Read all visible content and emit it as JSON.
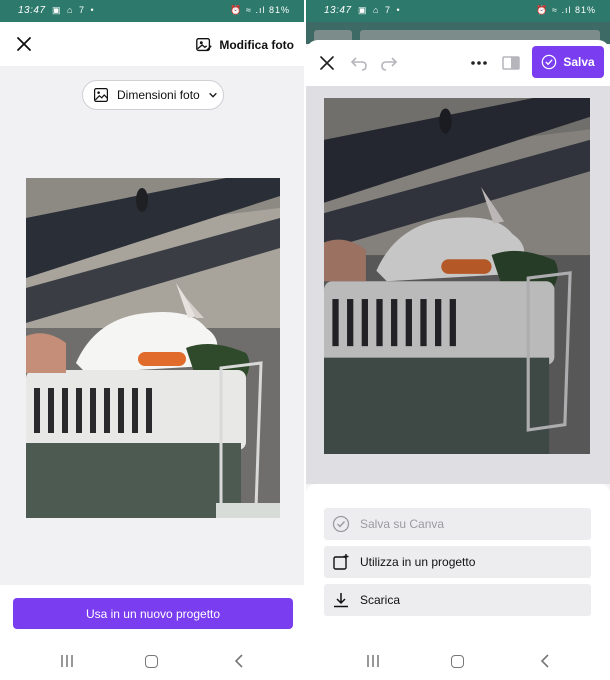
{
  "status": {
    "time": "13:47",
    "left_icons": "▣ ⌂ 7 •",
    "right_icons": "⏰ ≈ .ıl 81%"
  },
  "left": {
    "top_bar": {
      "edit_label": "Modifica foto"
    },
    "size_button": {
      "label": "Dimensioni foto"
    },
    "primary_button": {
      "label": "Usa in un nuovo progetto"
    }
  },
  "right": {
    "editor": {
      "save_label": "Salva"
    },
    "sheet": {
      "items": [
        {
          "label": "Salva su Canva",
          "icon": "check-circle-icon",
          "enabled": false
        },
        {
          "label": "Utilizza in un progetto",
          "icon": "add-to-project-icon",
          "enabled": true
        },
        {
          "label": "Scarica",
          "icon": "download-icon",
          "enabled": true
        }
      ]
    }
  },
  "colors": {
    "accent": "#7a3df0",
    "status_bar": "#2d7a6c"
  }
}
